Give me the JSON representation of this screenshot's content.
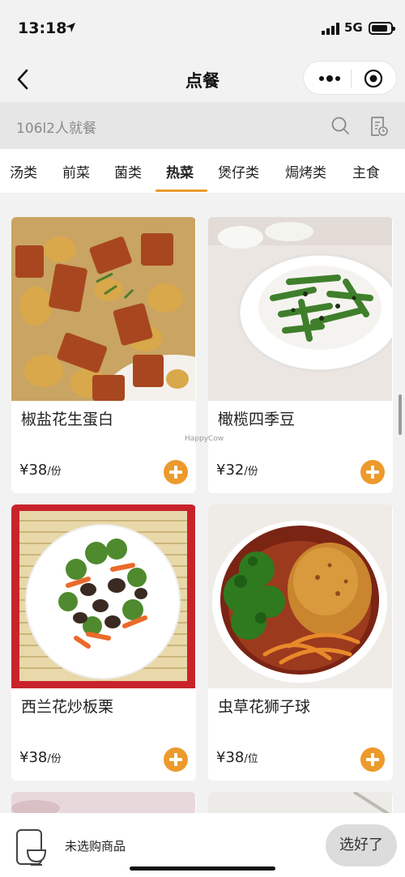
{
  "status_bar": {
    "time": "13:18",
    "network": "5G"
  },
  "nav": {
    "title": "点餐"
  },
  "table_info": "106l2人就餐",
  "tabs": [
    {
      "label": "汤类"
    },
    {
      "label": "前菜"
    },
    {
      "label": "菌类"
    },
    {
      "label": "热菜"
    },
    {
      "label": "煲仔类"
    },
    {
      "label": "焗烤类"
    },
    {
      "label": "主食"
    }
  ],
  "active_tab": "热菜",
  "dishes": [
    {
      "name": "椒盐花生蛋白",
      "currency": "¥",
      "price": "38",
      "unit": "/份"
    },
    {
      "name": "橄榄四季豆",
      "currency": "¥",
      "price": "32",
      "unit": "/份"
    },
    {
      "name": "西兰花炒板栗",
      "currency": "¥",
      "price": "38",
      "unit": "/份"
    },
    {
      "name": "虫草花狮子球",
      "currency": "¥",
      "price": "38",
      "unit": "/位"
    }
  ],
  "watermark": "HappyCow",
  "bottom": {
    "cart_text": "未选购商品",
    "done_label": "选好了"
  },
  "colors": {
    "accent": "#ec9a2c",
    "background": "#f2f2f2"
  }
}
